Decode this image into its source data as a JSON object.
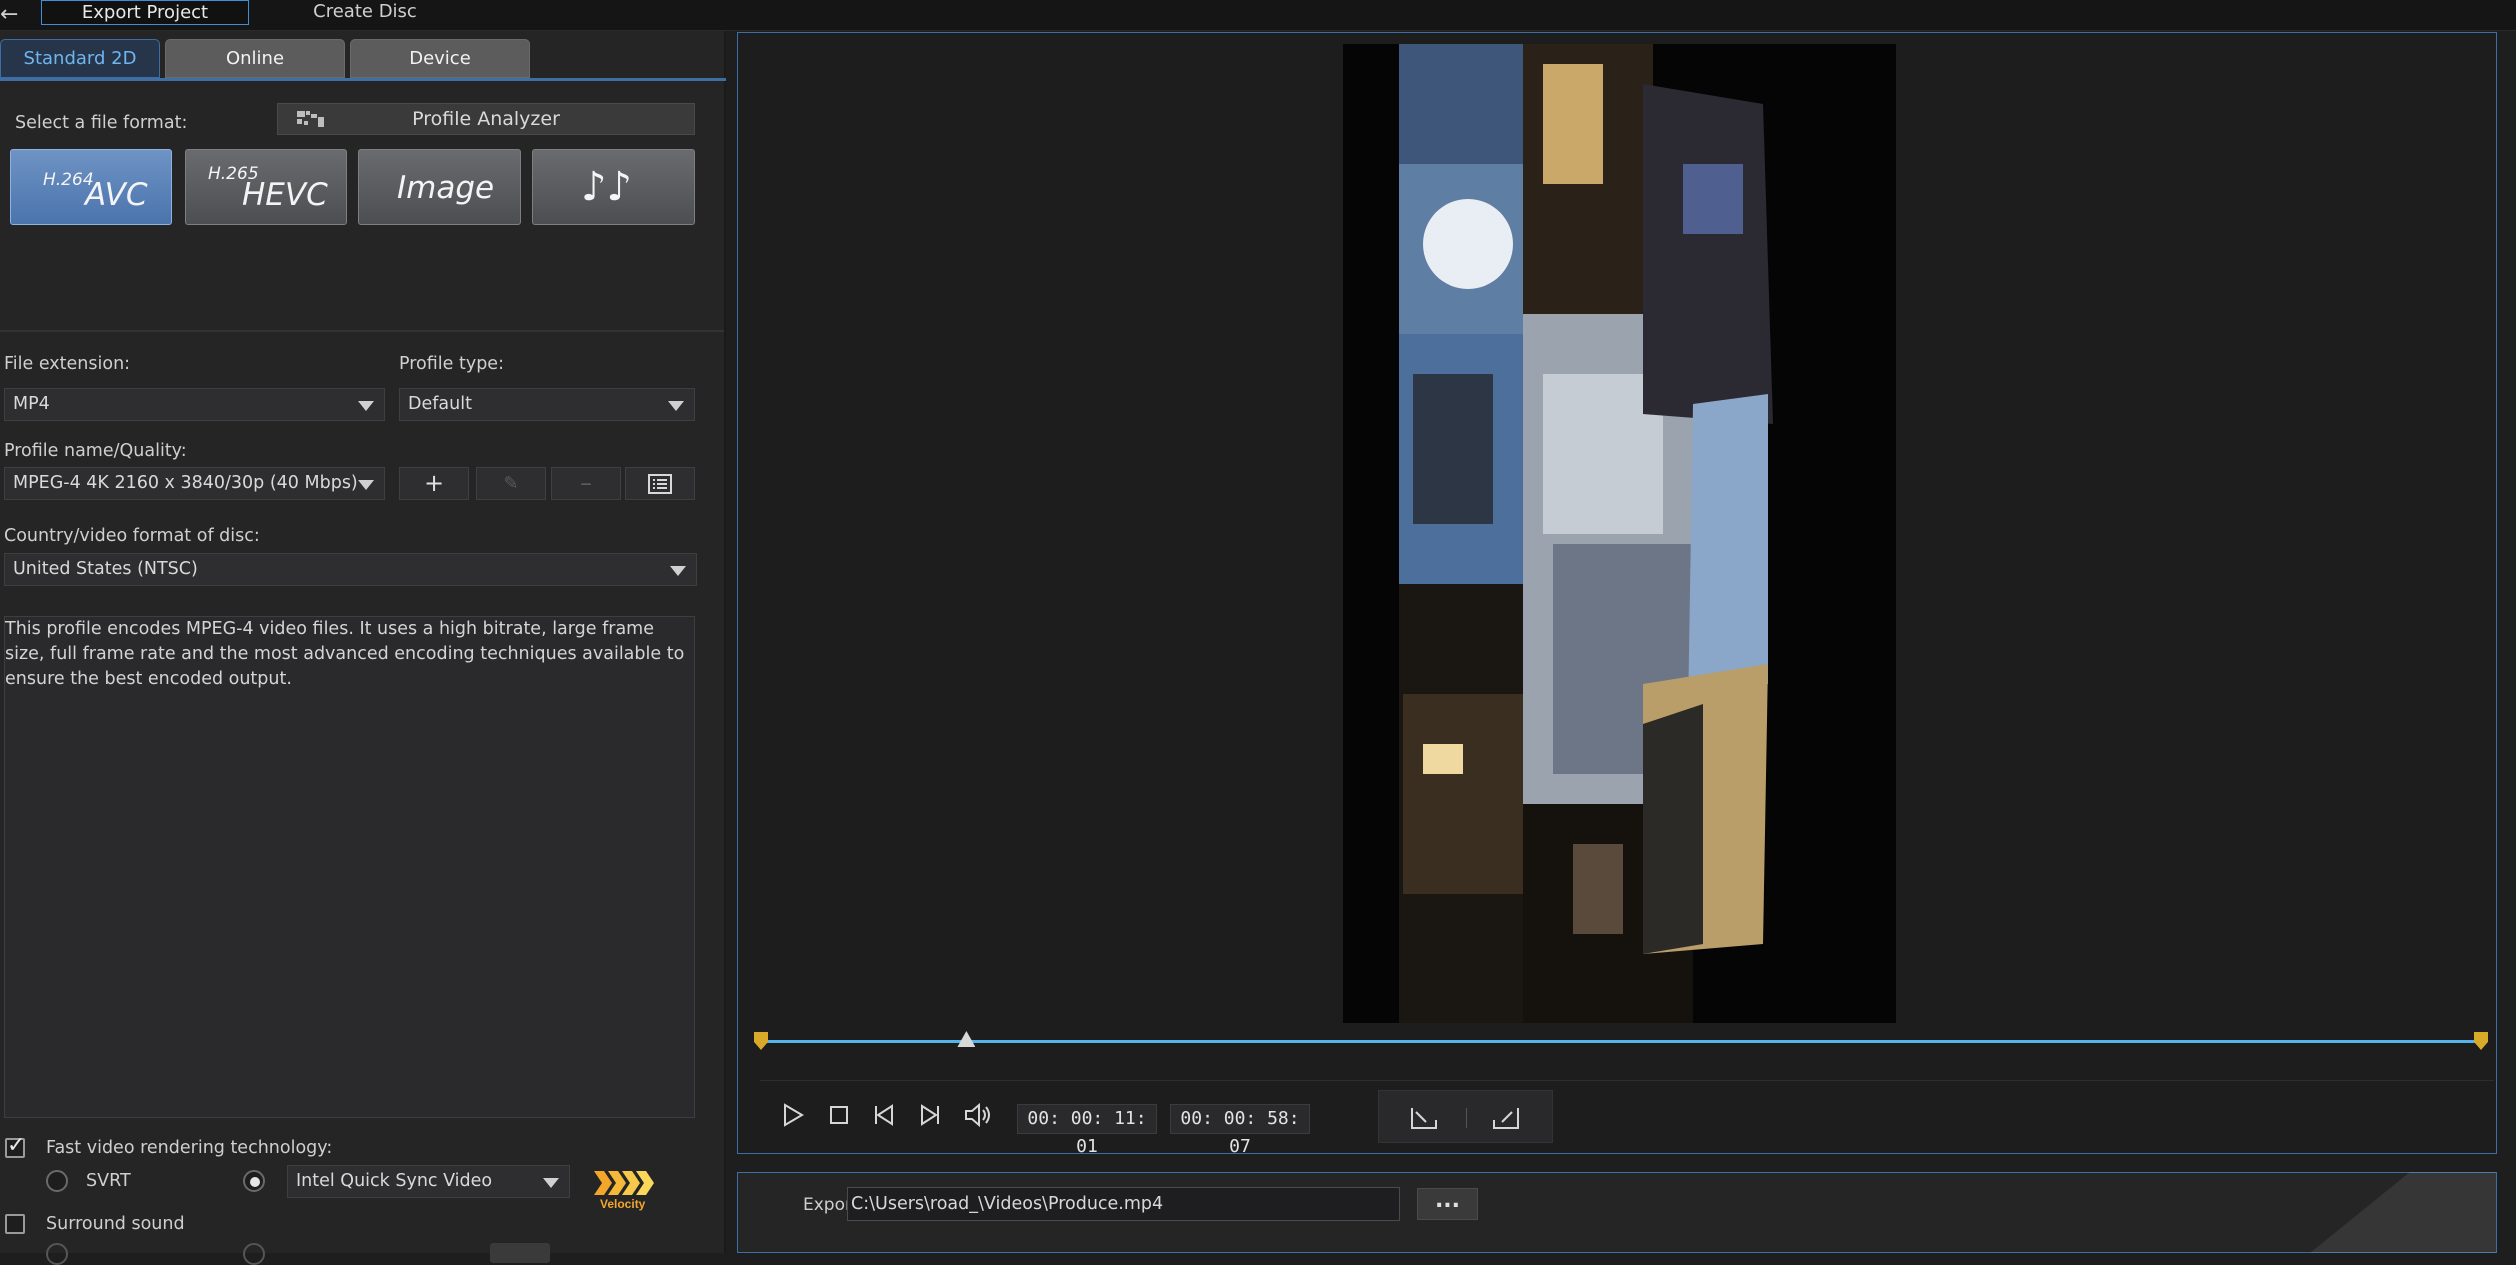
{
  "top_tabs": {
    "export": "Export Project",
    "disc": "Create Disc"
  },
  "sub_tabs": {
    "standard": "Standard 2D",
    "online": "Online",
    "device": "Device"
  },
  "format": {
    "label": "Select a file format:",
    "profile_analyzer": "Profile Analyzer",
    "buttons": {
      "avc_sup": "H.264",
      "avc_main": "AVC",
      "hevc_sup": "H.265",
      "hevc_main": "HEVC",
      "image_main": "Image",
      "audio_main": "♪♪"
    }
  },
  "file_extension": {
    "label": "File extension:",
    "value": "MP4"
  },
  "profile_type": {
    "label": "Profile type:",
    "value": "Default"
  },
  "profile_name": {
    "label": "Profile name/Quality:",
    "value": "MPEG-4 4K 2160 x 3840/30p (40 Mbps)"
  },
  "country": {
    "label": "Country/video format of disc:",
    "value": "United States (NTSC)"
  },
  "description": "This profile encodes MPEG-4 video files. It uses a high bitrate, large frame size, full frame rate and the most advanced encoding techniques available to ensure the best encoded output.",
  "fast_render": {
    "label": "Fast video rendering technology:",
    "checked": true,
    "svrt": "SVRT",
    "engine": "Intel Quick Sync Video"
  },
  "velocity_logo": {
    "text": "Velocity"
  },
  "surround": {
    "label": "Surround sound",
    "checked": false
  },
  "player": {
    "current_time": "00: 00: 11: 01",
    "total_time": "00: 00: 58: 07",
    "playhead_fraction": 0.12
  },
  "export": {
    "label": "Export to:",
    "path": "C:\\Users\\road_\\Videos\\Produce.mp4",
    "browse": "..."
  },
  "colors": {
    "accent": "#3f8fd6",
    "timeline": "#56b4ec",
    "marker": "#d9a92a",
    "active_format": "#4b74ad"
  }
}
